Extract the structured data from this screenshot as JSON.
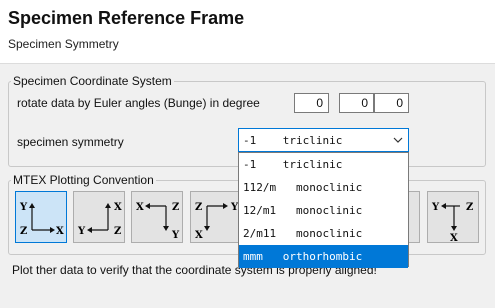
{
  "header": {
    "title": "Specimen Reference Frame",
    "subtitle": "Specimen Symmetry"
  },
  "coordinate_system": {
    "legend": "Specimen Coordinate System",
    "euler_label": "rotate data by Euler angles (Bunge) in degree",
    "euler_angles": [
      "0",
      "0",
      "0"
    ],
    "symmetry_label": "specimen symmetry",
    "symmetry_selected": "-1    triclinic",
    "symmetry_options": [
      "-1    triclinic",
      "112/m   monoclinic",
      "12/m1   monoclinic",
      "2/m11   monoclinic",
      "mmm   orthorhombic"
    ]
  },
  "plotting": {
    "legend": "MTEX Plotting Convention",
    "conventions": [
      {
        "name": "x-east-z-into",
        "up": "Y",
        "right": "X",
        "corner": "Z",
        "active": true
      },
      {
        "name": "y-west",
        "up": "X",
        "right": "Z",
        "corner": "Y",
        "active": false
      },
      {
        "name": "x-north",
        "left": "X",
        "right": "Z",
        "down": "Y",
        "active": false
      },
      {
        "name": "z-north",
        "left": "Z",
        "right": "Y",
        "down": "X",
        "active": false
      },
      {
        "name": "hidden-1",
        "active": false
      },
      {
        "name": "x-west",
        "left": "Y",
        "right": "Z",
        "down": "X",
        "active": false
      }
    ]
  },
  "footer": {
    "hint": "Plot ther data to verify that the coordinate system is properly aligned!"
  },
  "colors": {
    "accent": "#0078d7",
    "active_button": "#cce4f7"
  }
}
